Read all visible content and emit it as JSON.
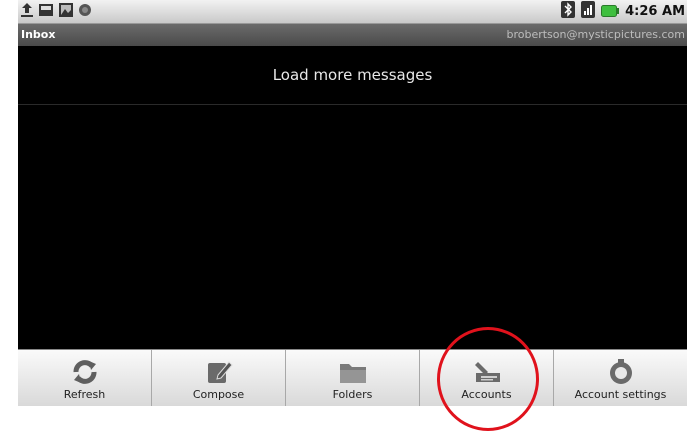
{
  "status_bar": {
    "time": "4:26 AM",
    "icons_left": [
      "usb-upload-icon",
      "sd-card-icon",
      "image-icon",
      "notification-dot-icon"
    ],
    "icons_right": [
      "bluetooth-icon",
      "signal-icon",
      "battery-icon"
    ],
    "battery_color": "#3fbf3f"
  },
  "title_bar": {
    "folder": "Inbox",
    "account": "brobertson@mysticpictures.com"
  },
  "load_more": {
    "label": "Load more messages"
  },
  "menu": {
    "items": [
      {
        "label": "Refresh",
        "icon": "refresh-icon"
      },
      {
        "label": "Compose",
        "icon": "compose-icon"
      },
      {
        "label": "Folders",
        "icon": "folder-icon"
      },
      {
        "label": "Accounts",
        "icon": "accounts-icon"
      },
      {
        "label": "Account settings",
        "icon": "settings-icon"
      }
    ]
  },
  "annotation": {
    "highlighted": "Accounts",
    "color": "#e0121c"
  }
}
